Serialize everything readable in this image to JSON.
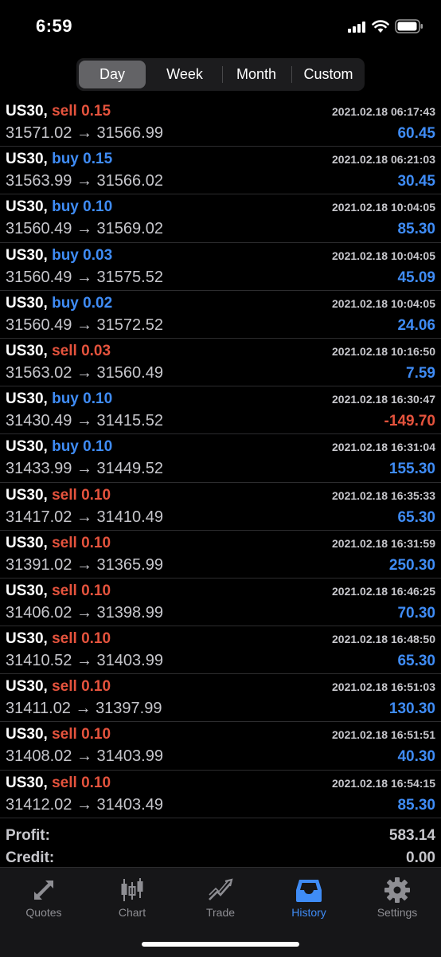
{
  "status": {
    "time": "6:59"
  },
  "period_tabs": [
    "Day",
    "Week",
    "Month",
    "Custom"
  ],
  "selected_tab": "Day",
  "trades": [
    {
      "symbol": "US30,",
      "side": "sell",
      "volume": "0.15",
      "open": "31571.02",
      "close": "31566.99",
      "datetime": "2021.02.18 06:17:43",
      "profit": "60.45"
    },
    {
      "symbol": "US30,",
      "side": "buy",
      "volume": "0.15",
      "open": "31563.99",
      "close": "31566.02",
      "datetime": "2021.02.18 06:21:03",
      "profit": "30.45"
    },
    {
      "symbol": "US30,",
      "side": "buy",
      "volume": "0.10",
      "open": "31560.49",
      "close": "31569.02",
      "datetime": "2021.02.18 10:04:05",
      "profit": "85.30"
    },
    {
      "symbol": "US30,",
      "side": "buy",
      "volume": "0.03",
      "open": "31560.49",
      "close": "31575.52",
      "datetime": "2021.02.18 10:04:05",
      "profit": "45.09"
    },
    {
      "symbol": "US30,",
      "side": "buy",
      "volume": "0.02",
      "open": "31560.49",
      "close": "31572.52",
      "datetime": "2021.02.18 10:04:05",
      "profit": "24.06"
    },
    {
      "symbol": "US30,",
      "side": "sell",
      "volume": "0.03",
      "open": "31563.02",
      "close": "31560.49",
      "datetime": "2021.02.18 10:16:50",
      "profit": "7.59"
    },
    {
      "symbol": "US30,",
      "side": "buy",
      "volume": "0.10",
      "open": "31430.49",
      "close": "31415.52",
      "datetime": "2021.02.18 16:30:47",
      "profit": "-149.70"
    },
    {
      "symbol": "US30,",
      "side": "buy",
      "volume": "0.10",
      "open": "31433.99",
      "close": "31449.52",
      "datetime": "2021.02.18 16:31:04",
      "profit": "155.30"
    },
    {
      "symbol": "US30,",
      "side": "sell",
      "volume": "0.10",
      "open": "31417.02",
      "close": "31410.49",
      "datetime": "2021.02.18 16:35:33",
      "profit": "65.30"
    },
    {
      "symbol": "US30,",
      "side": "sell",
      "volume": "0.10",
      "open": "31391.02",
      "close": "31365.99",
      "datetime": "2021.02.18 16:31:59",
      "profit": "250.30"
    },
    {
      "symbol": "US30,",
      "side": "sell",
      "volume": "0.10",
      "open": "31406.02",
      "close": "31398.99",
      "datetime": "2021.02.18 16:46:25",
      "profit": "70.30"
    },
    {
      "symbol": "US30,",
      "side": "sell",
      "volume": "0.10",
      "open": "31410.52",
      "close": "31403.99",
      "datetime": "2021.02.18 16:48:50",
      "profit": "65.30"
    },
    {
      "symbol": "US30,",
      "side": "sell",
      "volume": "0.10",
      "open": "31411.02",
      "close": "31397.99",
      "datetime": "2021.02.18 16:51:03",
      "profit": "130.30"
    },
    {
      "symbol": "US30,",
      "side": "sell",
      "volume": "0.10",
      "open": "31408.02",
      "close": "31403.99",
      "datetime": "2021.02.18 16:51:51",
      "profit": "40.30"
    },
    {
      "symbol": "US30,",
      "side": "sell",
      "volume": "0.10",
      "open": "31412.02",
      "close": "31403.49",
      "datetime": "2021.02.18 16:54:15",
      "profit": "85.30"
    }
  ],
  "arrow": "→",
  "summary": {
    "profit_label": "Profit:",
    "profit_value": "583.14",
    "credit_label": "Credit:",
    "credit_value": "0.00"
  },
  "tabbar": {
    "items": [
      {
        "label": "Quotes",
        "icon": "quotes-arrows-icon"
      },
      {
        "label": "Chart",
        "icon": "candlestick-chart-icon"
      },
      {
        "label": "Trade",
        "icon": "trend-line-icon"
      },
      {
        "label": "History",
        "icon": "inbox-tray-icon"
      },
      {
        "label": "Settings",
        "icon": "gear-icon"
      }
    ],
    "active": "History"
  },
  "colors": {
    "sell": "#e5533d",
    "buy": "#3f8cf6",
    "positive": "#3f8cf6",
    "negative": "#e5533d",
    "active_tab": "#3f8cf6",
    "inactive_tab": "#8e8e93"
  }
}
